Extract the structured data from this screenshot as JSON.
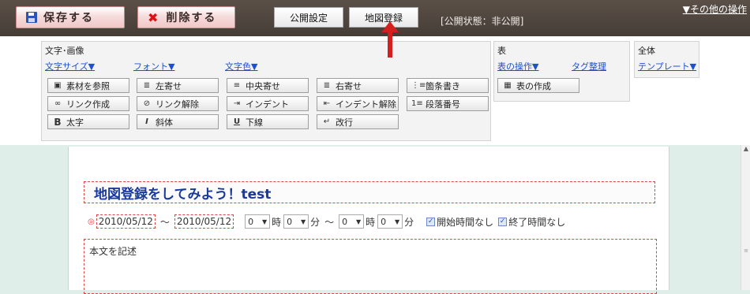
{
  "topbar": {
    "save_label": "保存する",
    "delete_label": "削除する",
    "tab_public": "公開設定",
    "tab_map": "地図登録",
    "status": "[公開状態：非公開]",
    "other_ops": "▼その他の操作"
  },
  "panels": {
    "text": {
      "title": "文字･画像",
      "links": [
        "文字サイズ▼",
        "フォント▼",
        "文字色▼"
      ],
      "rows": [
        [
          "素材を参照",
          "左寄せ",
          "中央寄せ",
          "右寄せ",
          "箇条書き"
        ],
        [
          "リンク作成",
          "リンク解除",
          "インデント",
          "インデント解除",
          "段落番号"
        ],
        [
          "太字",
          "斜体",
          "下線",
          "改行"
        ]
      ],
      "icons": [
        [
          "image-icon",
          "align-left-icon",
          "align-center-icon",
          "align-right-icon",
          "bullet-list-icon"
        ],
        [
          "link-icon",
          "unlink-icon",
          "indent-icon",
          "outdent-icon",
          "numbered-list-icon"
        ],
        [
          "bold-icon",
          "italic-icon",
          "underline-icon",
          "line-break-icon"
        ]
      ]
    },
    "table": {
      "title": "表",
      "link_ops": "表の操作▼",
      "link_tag": "タグ整理",
      "create_label": "表の作成"
    },
    "all": {
      "title": "全体",
      "link_template": "テンプレート▼"
    }
  },
  "editor": {
    "title": "地図登録をしてみよう！test",
    "start_date": "2010/05/12",
    "tilde": "～",
    "end_date": "2010/05/12",
    "start_hour": "0",
    "start_min": "0",
    "end_hour": "0",
    "end_min": "0",
    "hour_unit": "時",
    "min_unit": "分",
    "no_start_label": "開始時間なし",
    "no_end_label": "終了時間なし",
    "body_placeholder": "本文を記述"
  },
  "colors": {
    "topbar": "#4f463f",
    "title_text": "#1a3a9a",
    "dashed_border": "#dd4444",
    "arrow": "#d41f1f"
  }
}
